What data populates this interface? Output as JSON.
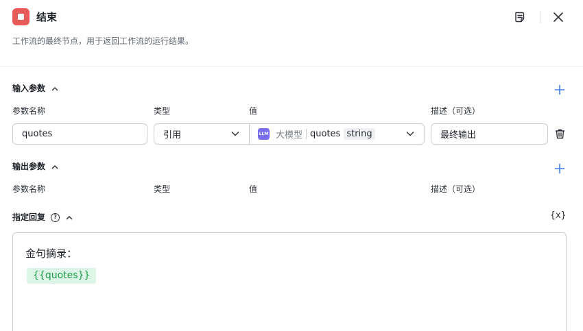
{
  "header": {
    "title": "结束",
    "description": "工作流的最终节点，用于返回工作流的运行结果。",
    "accent": "#e85b5b",
    "icons": [
      "notes-icon",
      "close-icon"
    ]
  },
  "input_section": {
    "title": "输入参数",
    "columns": [
      "参数名称",
      "类型",
      "值",
      "描述（可选）"
    ],
    "row": {
      "name": "quotes",
      "type": "引用",
      "ref_badge": "LLM",
      "ref_node": "大模型",
      "ref_var": "quotes",
      "ref_type": "string",
      "description": "最终输出"
    }
  },
  "output_section": {
    "title": "输出参数",
    "columns": [
      "参数名称",
      "类型",
      "值",
      "描述（可选）"
    ]
  },
  "reply_section": {
    "title": "指定回复",
    "help": "?",
    "var_button": "{x}",
    "content_line": "金句摘录：",
    "variable": "{{quotes}}",
    "variable_color": "#1e9c4a"
  },
  "colors": {
    "plus": "#3f7cf0",
    "llm_badge": "#7a6df0"
  }
}
